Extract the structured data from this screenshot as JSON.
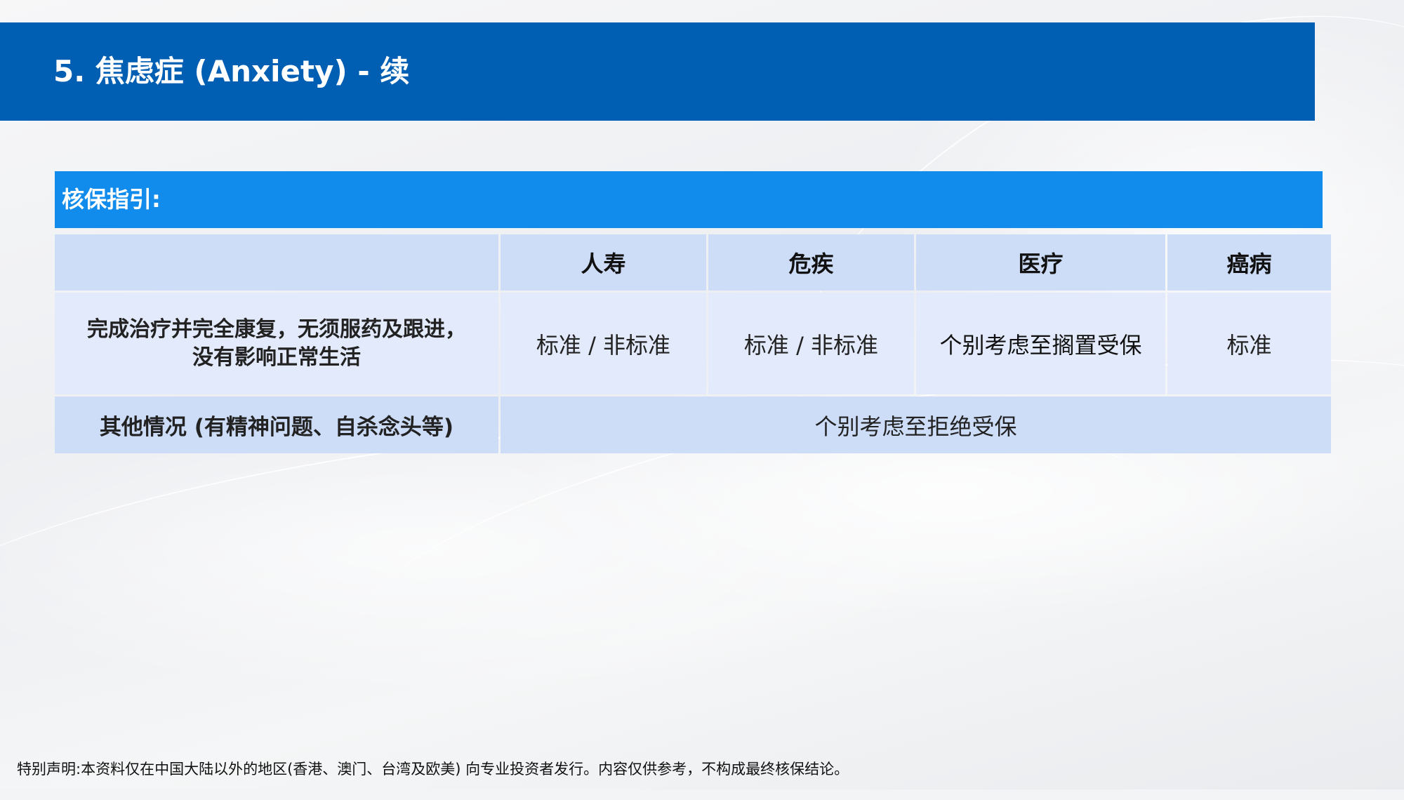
{
  "slide": {
    "title": "5. 焦虑症 (Anxiety) - 续",
    "section_label": "核保指引:"
  },
  "table": {
    "headers": [
      "",
      "人寿",
      "危疾",
      "医疗",
      "癌病"
    ],
    "rows": [
      {
        "label_line1": "完成治疗并完全康复，无须服药及跟进，",
        "label_line2": "没有影响正常生活",
        "cells": [
          "标准 / 非标准",
          "标准 / 非标准",
          "个别考虑至搁置受保",
          "标准"
        ]
      },
      {
        "label": "其他情况 (有精神问题、自杀念头等)",
        "merged_cell": "个别考虑至拒绝受保"
      }
    ]
  },
  "footer": {
    "disclaimer": "特别声明:本资料仅在中国大陆以外的地区(香港、澳门、台湾及欧美) 向专业投资者发行。内容仅供参考，不构成最终核保结论。"
  },
  "colors": {
    "title_bar": "#005eb3",
    "section_bar": "#118cec",
    "header_row": "#cddcf7",
    "body_row": "#e3eafb"
  }
}
